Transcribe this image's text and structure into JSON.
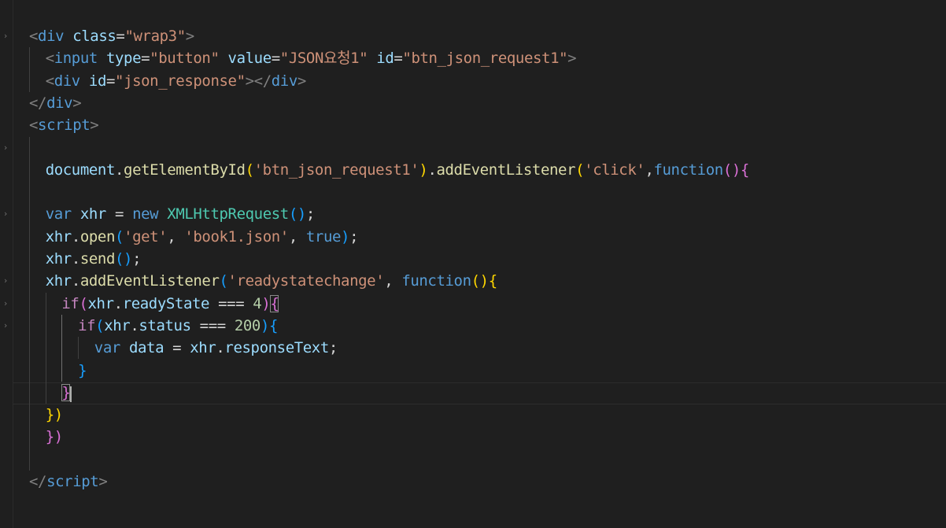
{
  "editor": {
    "language": "html",
    "colors": {
      "background": "#1f1f1f",
      "tag": "#569cd6",
      "attribute": "#9cdcfe",
      "string": "#ce9178",
      "function": "#dcdcaa",
      "control": "#c586c0",
      "class": "#4ec9b0",
      "number": "#b5cea8",
      "bracket1": "#ffd700",
      "bracket2": "#da70d6",
      "bracket3": "#179fff"
    },
    "fold_icon": "chevron-right-icon",
    "lines": [
      {
        "tokens": [
          [
            "t-punc",
            "<"
          ],
          [
            "t-tag",
            "div"
          ],
          [
            "t-plain",
            " "
          ],
          [
            "t-attr",
            "class"
          ],
          [
            "t-eq",
            "="
          ],
          [
            "t-str",
            "\"wrap3\""
          ],
          [
            "t-punc",
            ">"
          ]
        ]
      },
      {
        "tokens": [
          [
            "t-punc",
            "<"
          ],
          [
            "t-tag",
            "input"
          ],
          [
            "t-plain",
            " "
          ],
          [
            "t-attr",
            "type"
          ],
          [
            "t-eq",
            "="
          ],
          [
            "t-str",
            "\"button\""
          ],
          [
            "t-plain",
            " "
          ],
          [
            "t-attr",
            "value"
          ],
          [
            "t-eq",
            "="
          ],
          [
            "t-str",
            "\"JSON요청1\""
          ],
          [
            "t-plain",
            " "
          ],
          [
            "t-attr",
            "id"
          ],
          [
            "t-eq",
            "="
          ],
          [
            "t-str",
            "\"btn_json_request1\""
          ],
          [
            "t-punc",
            ">"
          ]
        ]
      },
      {
        "tokens": [
          [
            "t-punc",
            "<"
          ],
          [
            "t-tag",
            "div"
          ],
          [
            "t-plain",
            " "
          ],
          [
            "t-attr",
            "id"
          ],
          [
            "t-eq",
            "="
          ],
          [
            "t-str",
            "\"json_response\""
          ],
          [
            "t-punc",
            "></"
          ],
          [
            "t-tag",
            "div"
          ],
          [
            "t-punc",
            ">"
          ]
        ]
      },
      {
        "tokens": [
          [
            "t-punc",
            "</"
          ],
          [
            "t-tag",
            "div"
          ],
          [
            "t-punc",
            ">"
          ]
        ]
      },
      {
        "tokens": [
          [
            "t-punc",
            "<"
          ],
          [
            "t-tag",
            "script"
          ],
          [
            "t-punc",
            ">"
          ]
        ]
      },
      {
        "tokens": []
      },
      {
        "tokens": [
          [
            "t-var",
            "document"
          ],
          [
            "t-plain",
            "."
          ],
          [
            "t-fn",
            "getElementById"
          ],
          [
            "b1",
            "("
          ],
          [
            "t-str",
            "'btn_json_request1'"
          ],
          [
            "b1",
            ")"
          ],
          [
            "t-plain",
            "."
          ],
          [
            "t-fn",
            "addEventListener"
          ],
          [
            "b1",
            "("
          ],
          [
            "t-str",
            "'click'"
          ],
          [
            "t-plain",
            ","
          ],
          [
            "t-kw",
            "function"
          ],
          [
            "b2",
            "(){"
          ]
        ]
      },
      {
        "tokens": []
      },
      {
        "tokens": [
          [
            "t-kw",
            "var"
          ],
          [
            "t-plain",
            " "
          ],
          [
            "t-var",
            "xhr"
          ],
          [
            "t-plain",
            " = "
          ],
          [
            "t-kw",
            "new"
          ],
          [
            "t-plain",
            " "
          ],
          [
            "t-cls",
            "XMLHttpRequest"
          ],
          [
            "b3",
            "()"
          ],
          [
            "t-plain",
            ";"
          ]
        ]
      },
      {
        "tokens": [
          [
            "t-var",
            "xhr"
          ],
          [
            "t-plain",
            "."
          ],
          [
            "t-fn",
            "open"
          ],
          [
            "b3",
            "("
          ],
          [
            "t-str",
            "'get'"
          ],
          [
            "t-plain",
            ", "
          ],
          [
            "t-str",
            "'book1.json'"
          ],
          [
            "t-plain",
            ", "
          ],
          [
            "t-kw",
            "true"
          ],
          [
            "b3",
            ")"
          ],
          [
            "t-plain",
            ";"
          ]
        ]
      },
      {
        "tokens": [
          [
            "t-var",
            "xhr"
          ],
          [
            "t-plain",
            "."
          ],
          [
            "t-fn",
            "send"
          ],
          [
            "b3",
            "()"
          ],
          [
            "t-plain",
            ";"
          ]
        ]
      },
      {
        "tokens": [
          [
            "t-var",
            "xhr"
          ],
          [
            "t-plain",
            "."
          ],
          [
            "t-fn",
            "addEventListener"
          ],
          [
            "b3",
            "("
          ],
          [
            "t-str",
            "'readystatechange'"
          ],
          [
            "t-plain",
            ", "
          ],
          [
            "t-kw",
            "function"
          ],
          [
            "b1",
            "(){"
          ]
        ]
      },
      {
        "tokens": [
          [
            "t-ctrl",
            "if"
          ],
          [
            "b2",
            "("
          ],
          [
            "t-var",
            "xhr"
          ],
          [
            "t-plain",
            "."
          ],
          [
            "t-var",
            "readyState"
          ],
          [
            "t-plain",
            " === "
          ],
          [
            "t-num",
            "4"
          ],
          [
            "b2",
            ")"
          ],
          [
            "b2 bm",
            "{"
          ]
        ]
      },
      {
        "tokens": [
          [
            "t-ctrl",
            "if"
          ],
          [
            "b3",
            "("
          ],
          [
            "t-var",
            "xhr"
          ],
          [
            "t-plain",
            "."
          ],
          [
            "t-var",
            "status"
          ],
          [
            "t-plain",
            " === "
          ],
          [
            "t-num",
            "200"
          ],
          [
            "b3",
            ")"
          ],
          [
            "b3",
            "{"
          ]
        ]
      },
      {
        "tokens": [
          [
            "t-kw",
            "var"
          ],
          [
            "t-plain",
            " "
          ],
          [
            "t-var",
            "data"
          ],
          [
            "t-plain",
            " = "
          ],
          [
            "t-var",
            "xhr"
          ],
          [
            "t-plain",
            "."
          ],
          [
            "t-var",
            "responseText"
          ],
          [
            "t-plain",
            ";"
          ]
        ]
      },
      {
        "tokens": [
          [
            "b3",
            "}"
          ]
        ]
      },
      {
        "tokens": [
          [
            "b2 bm",
            "}"
          ]
        ]
      },
      {
        "tokens": [
          [
            "b1",
            "})"
          ]
        ]
      },
      {
        "tokens": [
          [
            "b2",
            "})"
          ]
        ]
      },
      {
        "tokens": []
      },
      {
        "tokens": [
          [
            "t-punc",
            "</"
          ],
          [
            "t-tag",
            "script"
          ],
          [
            "t-punc",
            ">"
          ]
        ]
      }
    ]
  }
}
